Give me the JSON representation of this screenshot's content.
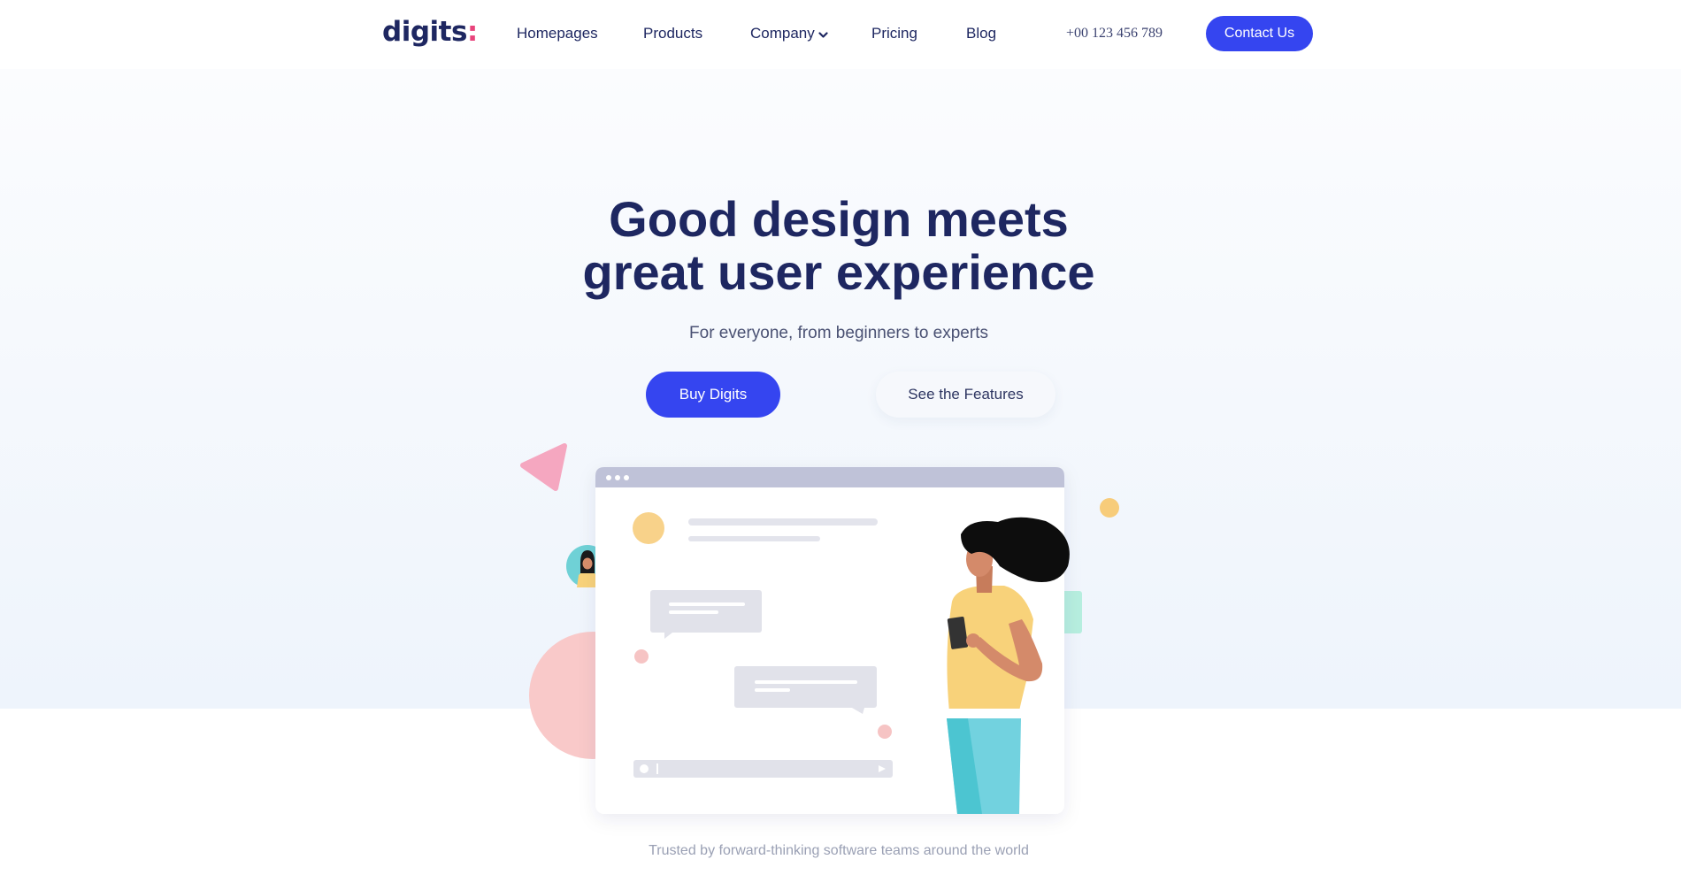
{
  "header": {
    "logo": {
      "text": "digits",
      "accent": ":"
    },
    "nav": [
      {
        "label": "Homepages"
      },
      {
        "label": "Products"
      },
      {
        "label": "Company",
        "has_dropdown": true,
        "icon": "chevron-down-icon"
      },
      {
        "label": "Pricing"
      },
      {
        "label": "Blog"
      }
    ],
    "phone": "+00 123 456 789",
    "contact_label": "Contact Us"
  },
  "hero": {
    "title_line1": "Good design meets",
    "title_line2": "great user experience",
    "subtitle": "For everyone, from beginners to experts",
    "primary_cta": "Buy Digits",
    "secondary_cta": "See the Features"
  },
  "trusted_text": "Trusted by forward-thinking software teams around the world",
  "colors": {
    "brand_blue": "#3545f0",
    "navy": "#1e2761",
    "logo_accent": "#e8437b"
  }
}
